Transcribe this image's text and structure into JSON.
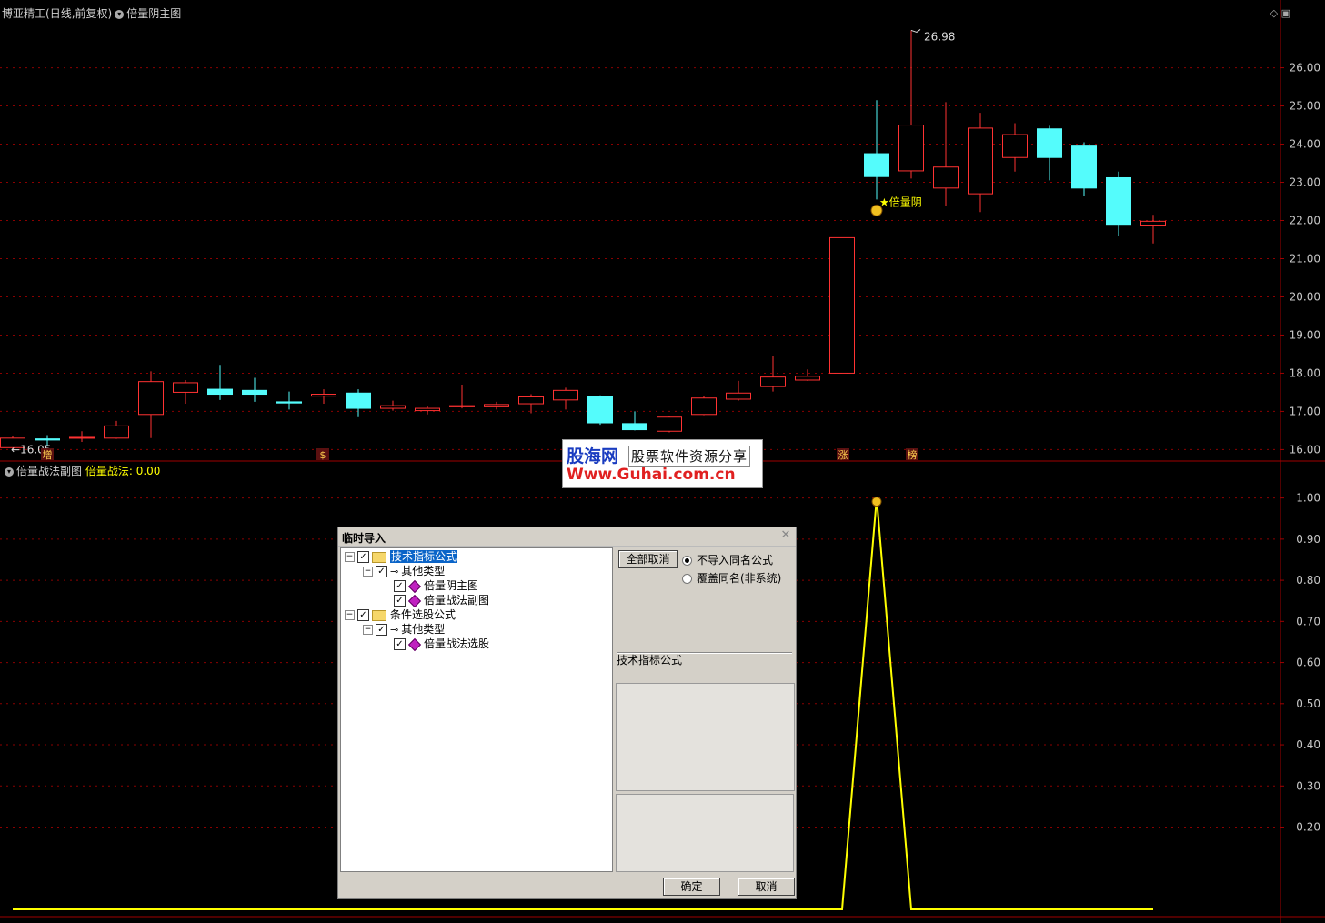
{
  "header": {
    "stock_name": "博亚精工",
    "period": "(日线,前复权)",
    "main_indicator": "倍量阴主图"
  },
  "sub_header": {
    "indicator": "倍量战法副图",
    "value_label": "倍量战法: 0.00"
  },
  "colors": {
    "up": "#ff3232",
    "down": "#54fcfc",
    "signal_line": "#ffff00",
    "grid": "#8b0000",
    "axis_text": "#c8c8c8"
  },
  "chart_data": [
    {
      "type": "candlestick",
      "title": "倍量阴主图",
      "ylim": [
        15.7,
        27.3
      ],
      "yticks": [
        "16.00",
        "17.00",
        "18.00",
        "19.00",
        "20.00",
        "21.00",
        "22.00",
        "23.00",
        "24.00",
        "25.00",
        "26.00"
      ],
      "candles": [
        {
          "o": 16.05,
          "h": 16.35,
          "l": 16.02,
          "c": 16.3
        },
        {
          "o": 16.28,
          "h": 16.38,
          "l": 16.1,
          "c": 16.25
        },
        {
          "o": 16.3,
          "h": 16.48,
          "l": 16.2,
          "c": 16.32
        },
        {
          "o": 16.3,
          "h": 16.75,
          "l": 16.28,
          "c": 16.62
        },
        {
          "o": 16.92,
          "h": 18.05,
          "l": 16.3,
          "c": 17.78
        },
        {
          "o": 17.5,
          "h": 17.82,
          "l": 17.2,
          "c": 17.75
        },
        {
          "o": 17.58,
          "h": 18.22,
          "l": 17.3,
          "c": 17.45
        },
        {
          "o": 17.55,
          "h": 17.88,
          "l": 17.25,
          "c": 17.45
        },
        {
          "o": 17.25,
          "h": 17.52,
          "l": 17.05,
          "c": 17.22
        },
        {
          "o": 17.4,
          "h": 17.58,
          "l": 17.2,
          "c": 17.45
        },
        {
          "o": 17.48,
          "h": 17.58,
          "l": 16.85,
          "c": 17.08
        },
        {
          "o": 17.08,
          "h": 17.28,
          "l": 17.02,
          "c": 17.15
        },
        {
          "o": 17.02,
          "h": 17.15,
          "l": 16.92,
          "c": 17.08
        },
        {
          "o": 17.12,
          "h": 17.7,
          "l": 17.08,
          "c": 17.15
        },
        {
          "o": 17.12,
          "h": 17.25,
          "l": 17.05,
          "c": 17.18
        },
        {
          "o": 17.2,
          "h": 17.45,
          "l": 16.95,
          "c": 17.38
        },
        {
          "o": 17.3,
          "h": 17.62,
          "l": 17.05,
          "c": 17.55
        },
        {
          "o": 17.38,
          "h": 17.42,
          "l": 16.65,
          "c": 16.7
        },
        {
          "o": 16.68,
          "h": 17.0,
          "l": 16.5,
          "c": 16.52
        },
        {
          "o": 16.48,
          "h": 16.88,
          "l": 16.45,
          "c": 16.85
        },
        {
          "o": 16.92,
          "h": 17.4,
          "l": 16.9,
          "c": 17.35
        },
        {
          "o": 17.32,
          "h": 17.8,
          "l": 17.28,
          "c": 17.48
        },
        {
          "o": 17.65,
          "h": 18.45,
          "l": 17.52,
          "c": 17.9
        },
        {
          "o": 17.82,
          "h": 18.1,
          "l": 17.8,
          "c": 17.92
        },
        {
          "o": 18.0,
          "h": 21.55,
          "l": 18.0,
          "c": 21.55
        },
        {
          "o": 23.75,
          "h": 25.15,
          "l": 22.55,
          "c": 23.15
        },
        {
          "o": 23.3,
          "h": 26.98,
          "l": 23.1,
          "c": 24.5
        },
        {
          "o": 22.85,
          "h": 25.1,
          "l": 22.38,
          "c": 23.4
        },
        {
          "o": 22.7,
          "h": 24.82,
          "l": 22.22,
          "c": 24.42
        },
        {
          "o": 23.65,
          "h": 24.55,
          "l": 23.28,
          "c": 24.25
        },
        {
          "o": 24.4,
          "h": 24.48,
          "l": 23.05,
          "c": 23.65
        },
        {
          "o": 23.95,
          "h": 24.05,
          "l": 22.65,
          "c": 22.85
        },
        {
          "o": 23.12,
          "h": 23.28,
          "l": 21.6,
          "c": 21.9
        },
        {
          "o": 21.88,
          "h": 22.15,
          "l": 21.4,
          "c": 21.98
        }
      ],
      "annotations": {
        "high_label": "26.98",
        "low_label": "16.05",
        "signal_label": "★倍量阴",
        "bottom_marks": [
          "增",
          "$",
          "涨",
          "榜"
        ]
      }
    },
    {
      "type": "line",
      "title": "倍量战法副图",
      "ylim": [
        0,
        1.05
      ],
      "yticks": [
        "0.20",
        "0.30",
        "0.40",
        "0.50",
        "0.60",
        "0.70",
        "0.80",
        "0.90",
        "1.00"
      ],
      "series": [
        {
          "values": [
            0,
            0,
            0,
            0,
            0,
            0,
            0,
            0,
            0,
            0,
            0,
            0,
            0,
            0,
            0,
            0,
            0,
            0,
            0,
            0,
            0,
            0,
            0,
            0,
            0,
            1,
            0,
            0,
            0,
            0,
            0,
            0,
            0,
            0
          ]
        }
      ]
    }
  ],
  "dialog": {
    "title": "临时导入",
    "tree": {
      "root1": "技术指标公式",
      "root1_child": "其他类型",
      "item1": "倍量阴主图",
      "item2": "倍量战法副图",
      "root2": "条件选股公式",
      "root2_child": "其他类型",
      "item3": "倍量战法选股"
    },
    "deselect_all": "全部取消",
    "radio_no_import": "不导入同名公式",
    "radio_overwrite": "覆盖同名(非系统)",
    "group_label": "技术指标公式",
    "ok": "确定",
    "cancel": "取消"
  },
  "watermark": {
    "logo": "股海网",
    "slogan": "股票软件资源分享",
    "url": "Www.Guhai.com.cn"
  }
}
